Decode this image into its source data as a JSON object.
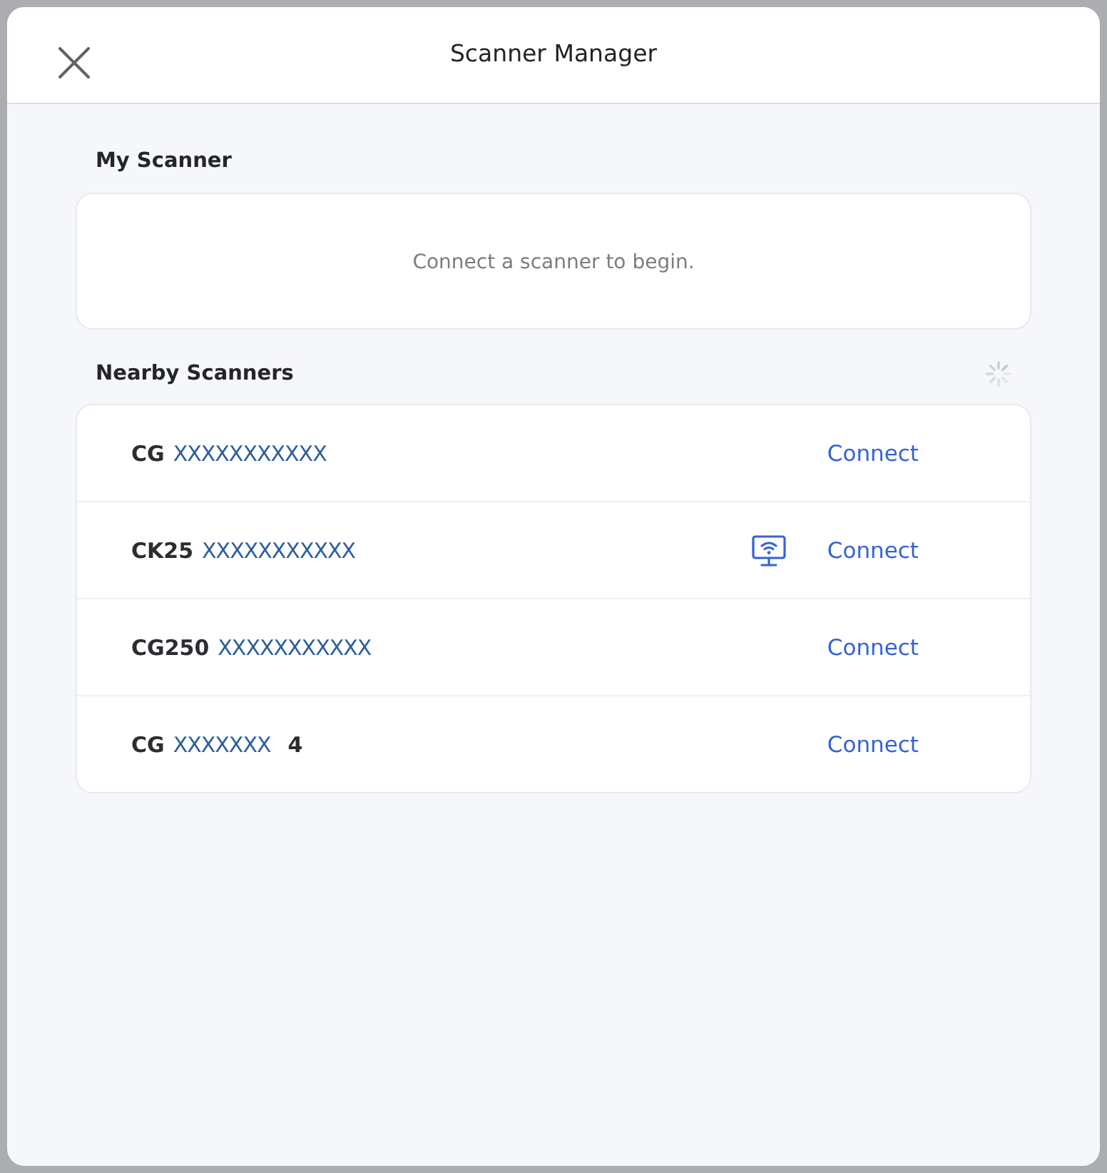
{
  "header": {
    "title": "Scanner Manager"
  },
  "my_scanner": {
    "heading": "My Scanner",
    "empty_message": "Connect a scanner to begin."
  },
  "nearby_scanners": {
    "heading": "Nearby Scanners",
    "loading": true,
    "items": [
      {
        "model": "CG",
        "serial": "XXXXXXXXXXX",
        "has_display": false,
        "action": "Connect"
      },
      {
        "model": "CK25",
        "serial": "XXXXXXXXXXX",
        "has_display": true,
        "action": "Connect"
      },
      {
        "model": "CG250",
        "serial": "XXXXXXXXXXX",
        "has_display": false,
        "action": "Connect"
      },
      {
        "model": "CG",
        "serial": "XXXXXXX",
        "suffix": "4",
        "has_display": false,
        "action": "Connect"
      }
    ]
  }
}
